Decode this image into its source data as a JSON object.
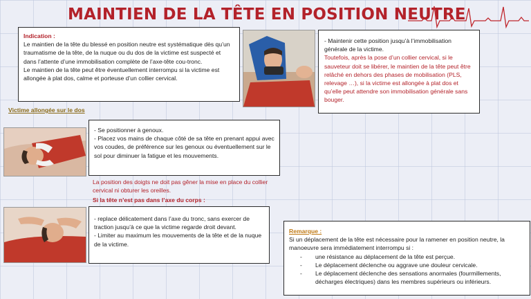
{
  "title": "MAINTIEN DE LA TÊTE EN POSITION NEUTRE",
  "indication": {
    "heading": "Indication :",
    "p1": "Le maintien de la tête du blessé en position neutre est systématique dès qu’un traumatisme de la tête, de la nuque ou du dos de la victime est suspecté et dans l’attente d’une immobilisation complète de l’axe-tête cou-tronc.",
    "p2": "Le maintien de la tête peut être éventuellement interrompu si la victime est allongée à plat dos, calme et porteuse d’un collier cervical."
  },
  "maintain": {
    "black": "- Maintenir cette position jusqu’à l’immobilisation générale de la victime.",
    "red": "Toutefois, après la pose d’un collier cervical, si le sauveteur doit se libérer, le maintien de la tête peut être relâché en dehors des phases de mobilisation (PLS, relevage …), si la victime est allongée à plat dos et qu’elle peut attendre son immobilisation générale sans bouger."
  },
  "section_label": "Victime allongée sur le dos",
  "steps": {
    "s1": "- Se positionner à genoux.",
    "s2": "- Placez vos mains de chaque côté de sa  tête en prenant appui avec vos coudes, de préférence sur les genoux ou éventuellement sur le sol pour diminuer la fatigue et les mouvements."
  },
  "fingers_note": "La position des doigts ne doit pas gêner la mise en place du collier cervical ni obturer les oreilles.",
  "axis_heading": "Si la tête n’est pas dans l’axe du corps :",
  "axis": {
    "s1": "- replace délicatement dans l’axe du tronc, sans exercer de traction jusqu’à ce que la victime regarde droit devant.",
    "s2": "- Limiter au maximum les mouvements de la tête et de  la nuque de la victime."
  },
  "remarque": {
    "heading": "Remarque :",
    "intro": "Si un déplacement de la tête est nécessaire pour la ramener en position neutre, la manoeuvre sera immédiatement interrompu si :",
    "items": [
      "une résistance au déplacement de la tête est perçue.",
      "Le déplacement déclenche ou aggrave une douleur cervicale.",
      "Le déplacement déclenche des sensations anormales (fourmillements, décharges électriques) dans les membres supérieurs ou inférieurs."
    ]
  },
  "colors": {
    "accent_red": "#b3222a",
    "orange": "#c07a16",
    "label_gold": "#8a6a17"
  }
}
